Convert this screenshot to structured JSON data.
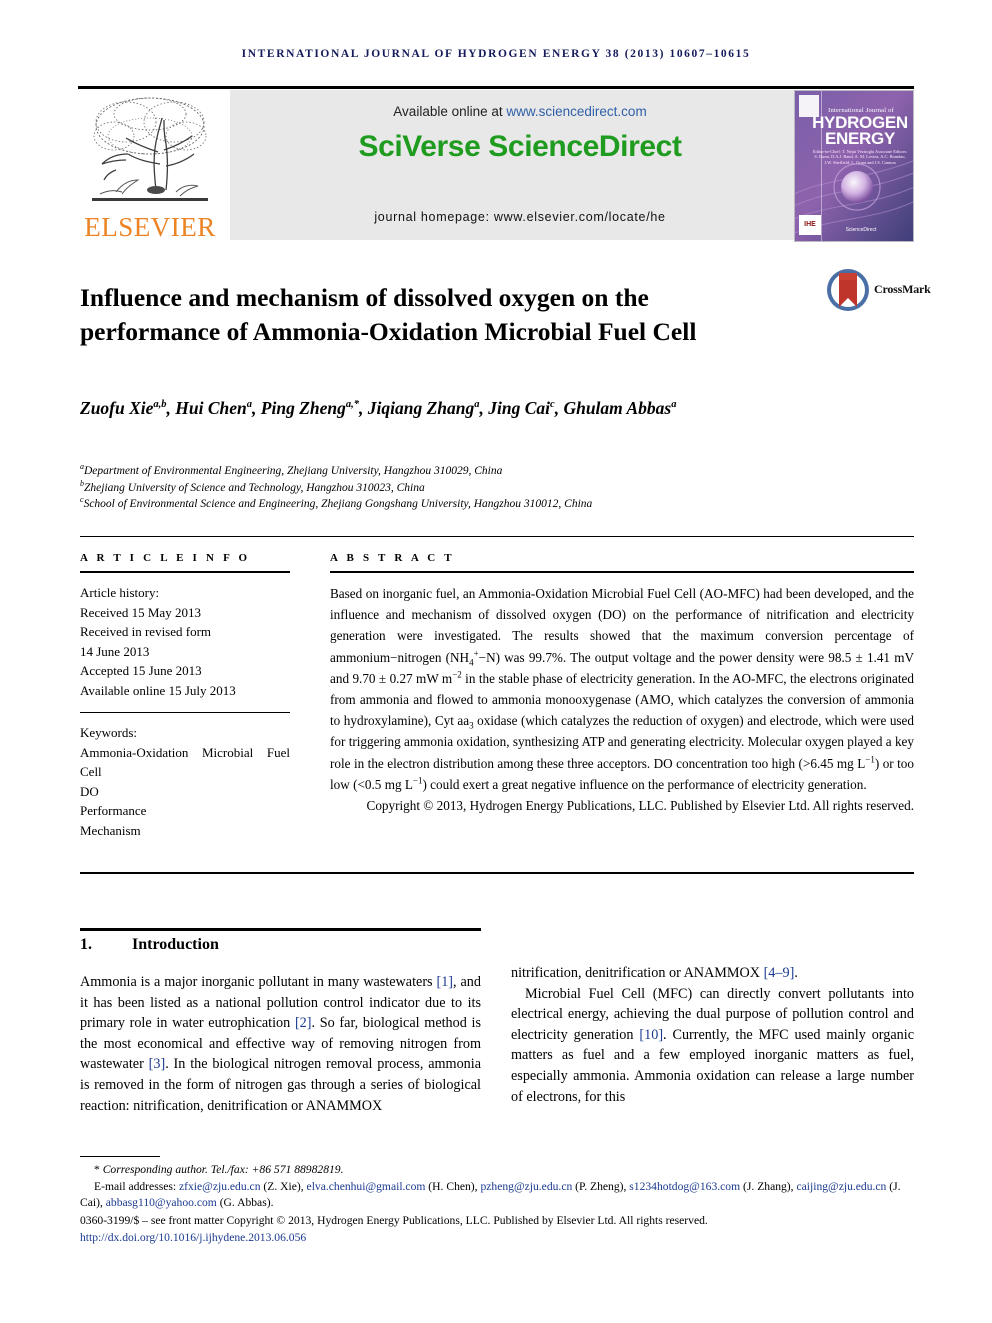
{
  "running_head": "INTERNATIONAL JOURNAL OF HYDROGEN ENERGY 38 (2013) 10607–10615",
  "masthead": {
    "publisher_name": "ELSEVIER",
    "publisher_logo_icon": "elsevier-tree-icon",
    "available_prefix": "Available online at ",
    "available_url": "www.sciencedirect.com",
    "brand": "SciVerse ScienceDirect",
    "homepage": "journal homepage: www.elsevier.com/locate/he",
    "cover": {
      "kicker": "International Journal of",
      "line1": "HYDROGEN",
      "line2": "ENERGY",
      "editors": "Editor-in-Chief: T. Nejat Veziroglu\nAssociate Editors: S. Dunn, D.A.J. Rand, A. M. Lovins, A.C. Brandao, J.W. Sheffield, L. Grant and J.S. Cannon",
      "sciencedirect_mark": "ScienceDirect",
      "ihe_mark": "IHE"
    },
    "colors": {
      "brand_green": "#1f9c1f",
      "link_blue": "#2f5fa8",
      "elsevier_orange": "#ec8426",
      "running_head_navy": "#141a5a",
      "cover_purple": "#6f5aa0"
    }
  },
  "article": {
    "title": "Influence and mechanism of dissolved oxygen on the performance of Ammonia-Oxidation Microbial Fuel Cell",
    "crossmark_label": "CrossMark",
    "crossmark_icon": "crossmark-logo-icon",
    "authors": [
      {
        "name": "Zuofu Xie",
        "marks": "a,b",
        "sep": ", "
      },
      {
        "name": "Hui Chen",
        "marks": "a",
        "sep": ", "
      },
      {
        "name": "Ping Zheng",
        "marks": "a,*",
        "sep": ", "
      },
      {
        "name": "Jiqiang Zhang",
        "marks": "a",
        "sep": ", "
      },
      {
        "name": "Jing Cai",
        "marks": "c",
        "sep": ", "
      },
      {
        "name": "Ghulam Abbas",
        "marks": "a",
        "sep": ""
      }
    ],
    "affiliations": [
      {
        "mark": "a",
        "text": "Department of Environmental Engineering, Zhejiang University, Hangzhou 310029, China"
      },
      {
        "mark": "b",
        "text": "Zhejiang University of Science and Technology, Hangzhou 310023, China"
      },
      {
        "mark": "c",
        "text": "School of Environmental Science and Engineering, Zhejiang Gongshang University, Hangzhou 310012, China"
      }
    ]
  },
  "article_info": {
    "heading": "A R T I C L E  I N F O",
    "history_label": "Article history:",
    "history": [
      "Received 15 May 2013",
      "Received in revised form",
      "14 June 2013",
      "Accepted 15 June 2013",
      "Available online 15 July 2013"
    ],
    "keywords_label": "Keywords:",
    "keywords": [
      "Ammonia-Oxidation Microbial Fuel Cell",
      "DO",
      "Performance",
      "Mechanism"
    ]
  },
  "abstract": {
    "heading": "A B S T R A C T",
    "body_part1": "Based on inorganic fuel, an Ammonia-Oxidation Microbial Fuel Cell (AO-MFC) had been developed, and the influence and mechanism of dissolved oxygen (DO) on the performance of nitrification and electricity generation were investigated. The results showed that the maximum conversion percentage of ammonium−nitrogen (NH",
    "nh4_sub": "4",
    "nh4_sup": "+",
    "body_part2": "−N) was 99.7%. The output voltage and the power density were 98.5 ± 1.41 mV and 9.70 ± 0.27 mW m",
    "m_sup": "−2",
    "body_part3": " in the stable phase of electricity generation. In the AO-MFC, the electrons originated from ammonia and flowed to ammonia monooxygenase (AMO, which catalyzes the conversion of ammonia to hydroxylamine), Cyt aa",
    "aa3_sub": "3",
    "body_part4": " oxidase (which catalyzes the reduction of oxygen) and electrode, which were used for triggering ammonia oxidation, synthesizing ATP and generating electricity. Molecular oxygen played a key role in the electron distribution among these three acceptors. DO concentration too high (>6.45 mg L",
    "l_sup1": "−1",
    "body_part5": ") or too low (<0.5 mg L",
    "l_sup2": "−1",
    "body_part6": ") could exert a great negative influence on the performance of electricity generation.",
    "copyright": "Copyright © 2013, Hydrogen Energy Publications, LLC. Published by Elsevier Ltd. All rights reserved."
  },
  "introduction": {
    "number": "1.",
    "heading": "Introduction",
    "left_paragraph_1_a": "Ammonia is a major inorganic pollutant in many wastewaters ",
    "ref1": "[1]",
    "left_paragraph_1_b": ", and it has been listed as a national pollution control indicator due to its primary role in water eutrophication ",
    "ref2": "[2]",
    "left_paragraph_1_c": ". So far, biological method is the most economical and effective way of removing nitrogen from wastewater ",
    "ref3": "[3]",
    "left_paragraph_1_d": ". In the biological nitrogen removal process, ammonia is removed in the form of nitrogen gas through a series of biological reaction: nitrification, denitrification or ANAMMOX ",
    "ref49": "[4–9]",
    "left_paragraph_1_e": ".",
    "right_paragraph_2_a": "Microbial Fuel Cell (MFC) can directly convert pollutants into electrical energy, achieving the dual purpose of pollution control and electricity generation ",
    "ref10": "[10]",
    "right_paragraph_2_b": ". Currently, the MFC used mainly organic matters as fuel and a few employed inorganic matters as fuel, especially ammonia. Ammonia oxidation can release a large number of electrons, for this"
  },
  "footnotes": {
    "corresponding_star": "*",
    "corresponding": " Corresponding author. Tel./fax: +86 571 88982819.",
    "emails_label": "E-mail addresses: ",
    "emails": [
      {
        "address": "zfxie@zju.edu.cn",
        "who": " (Z. Xie), "
      },
      {
        "address": "elva.chenhui@gmail.com",
        "who": " (H. Chen), "
      },
      {
        "address": "pzheng@zju.edu.cn",
        "who": " (P. Zheng), "
      },
      {
        "address": "s1234hotdog@163.com",
        "who": " (J. Zhang), "
      },
      {
        "address": "caijing@zju.edu.cn",
        "who": " (J. Cai), "
      },
      {
        "address": "abbasg110@yahoo.com",
        "who": " (G. Abbas)."
      }
    ],
    "issn_line": "0360-3199/$ – see front matter Copyright © 2013, Hydrogen Energy Publications, LLC. Published by Elsevier Ltd. All rights reserved.",
    "doi": "http://dx.doi.org/10.1016/j.ijhydene.2013.06.056"
  }
}
